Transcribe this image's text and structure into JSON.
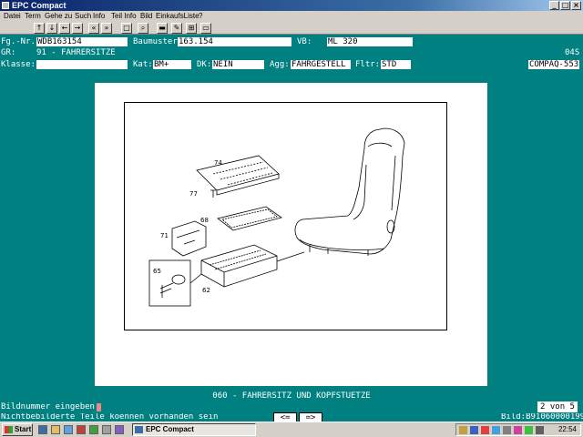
{
  "window": {
    "title": "EPC Compact"
  },
  "menu": [
    "Datei",
    "Term",
    "Gehe zu",
    "Such",
    "Info",
    "Teil Info",
    "Bild",
    "EinkaufsListe",
    "?"
  ],
  "toolbar": {
    "buttons": [
      "arrow-up",
      "arrow-down",
      "arrow-left",
      "arrow-right",
      "double-left",
      "double-right",
      "box",
      "search",
      "car",
      "pencil",
      "cart",
      "truck"
    ],
    "glyphs": {
      "up": "↑",
      "down": "↓",
      "left": "←",
      "right": "→",
      "dleft": "«",
      "dright": "»",
      "box": "□",
      "search": "⌕",
      "car": "▬",
      "pencil": "✎",
      "cart": "⊞",
      "truck": "▭"
    }
  },
  "header": {
    "fg_label": "Fg.-Nr.:",
    "fg_value": "WDB163154",
    "baumuster_label": "Baumuster:",
    "baumuster_value": "163.154",
    "vb_label": "VB:",
    "vb_value": "ML 320",
    "gr_label": "GR:",
    "gr_value": "91 - FAHRERSITZE",
    "code_right": "04S",
    "klasse_label": "Klasse:",
    "kat_label": "Kat:",
    "kat_value": "BM+",
    "dk_label": "DK:",
    "dk_value": "NEIN",
    "agg_label": "Agg:",
    "agg_value": "FAHRGESTELL",
    "fltr_label": "Fltr:",
    "fltr_value": "STD",
    "station": "COMPAQ-5537"
  },
  "drawing": {
    "part_numbers": [
      "74",
      "77",
      "68",
      "71",
      "65",
      "62"
    ]
  },
  "caption": "060 - FAHRERSITZ UND KOPFSTUETZE",
  "prompt": {
    "label": "Bildnummer eingeben:",
    "page": "2 von 5"
  },
  "message": "Nichtbebilderte Teile koennen vorhanden sein",
  "nav": {
    "prev": "<=",
    "next": "=>"
  },
  "bild": "Bild:B91060000199",
  "taskbar": {
    "start": "Start",
    "task": "EPC Compact",
    "clock": "22:54"
  },
  "colors": {
    "background": "#008080",
    "titlebar": "#0a246a",
    "panel": "#d4d0c8"
  }
}
